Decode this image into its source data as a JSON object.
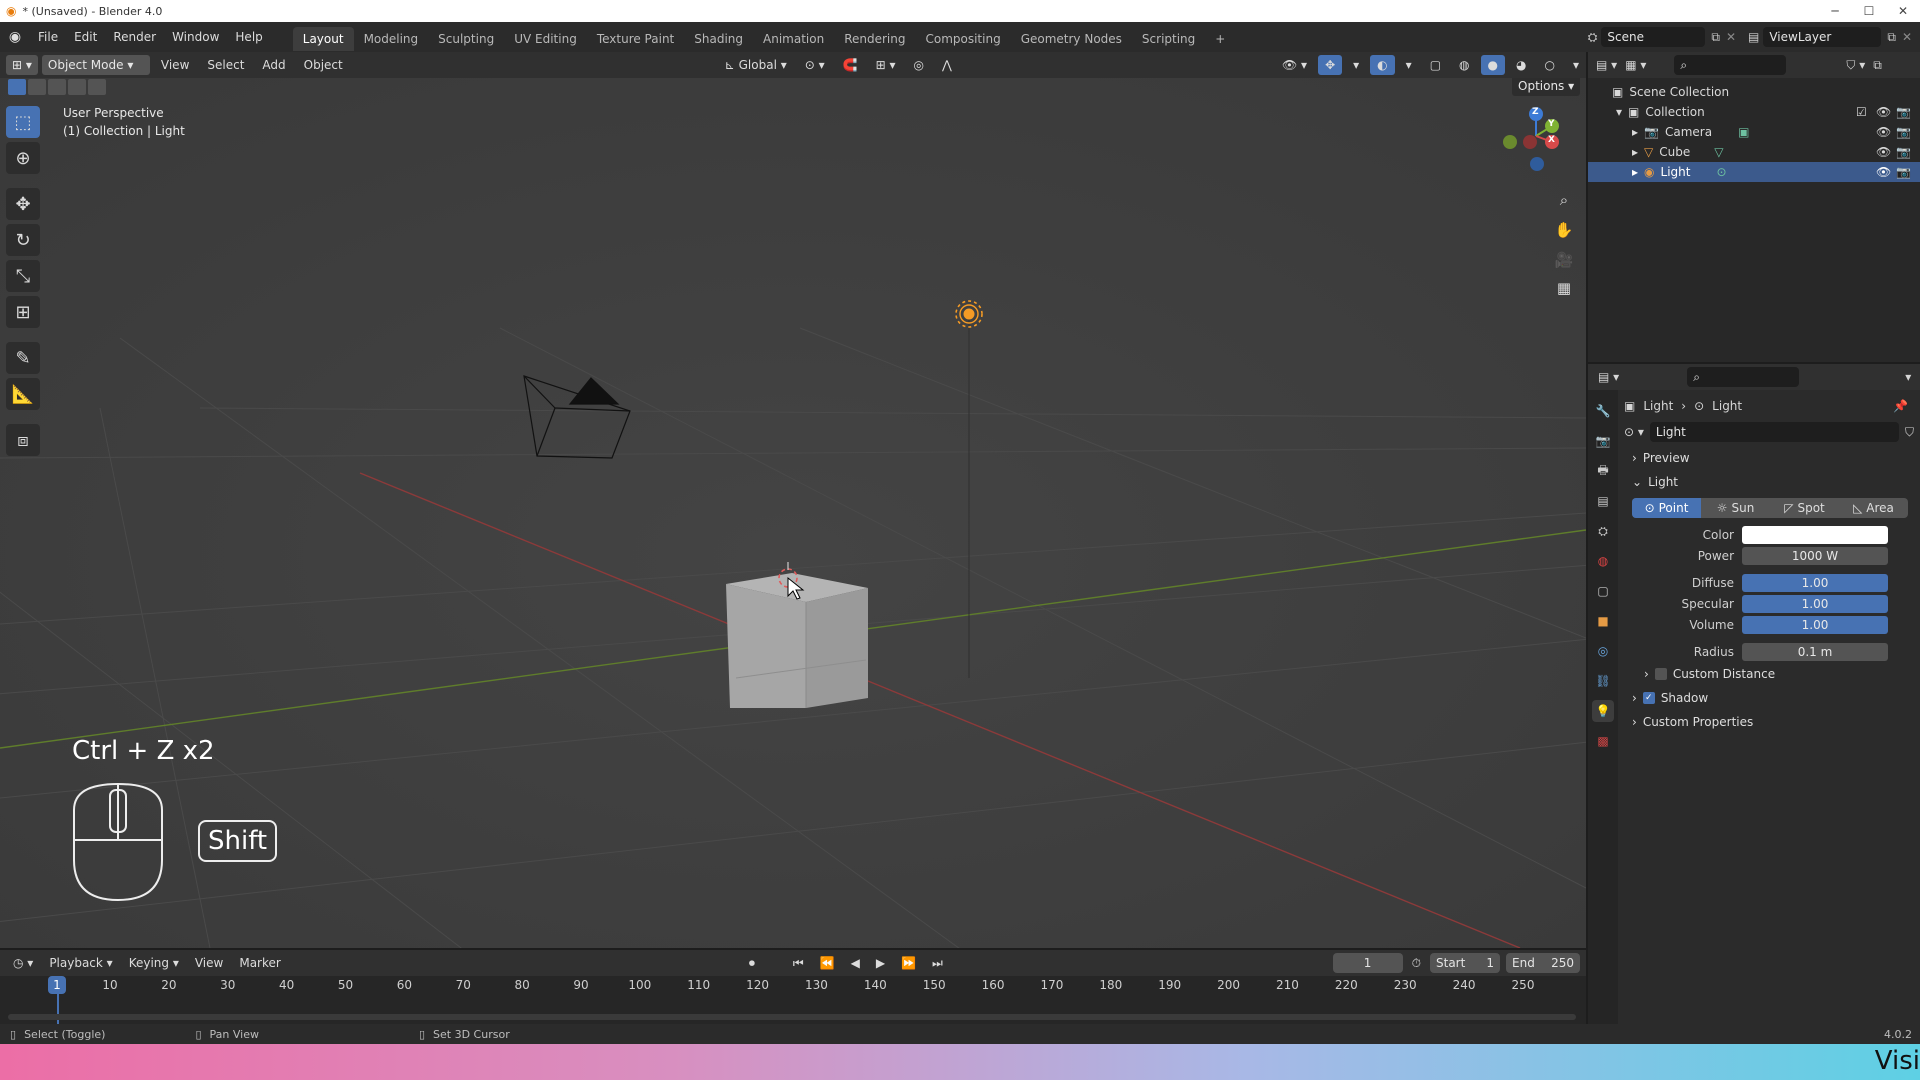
{
  "window": {
    "title": "* (Unsaved) - Blender 4.0",
    "controls": [
      "─",
      "☐",
      "✕"
    ]
  },
  "topbar": {
    "menus": [
      "File",
      "Edit",
      "Render",
      "Window",
      "Help"
    ],
    "workspace_tabs": [
      "Layout",
      "Modeling",
      "Sculpting",
      "UV Editing",
      "Texture Paint",
      "Shading",
      "Animation",
      "Rendering",
      "Compositing",
      "Geometry Nodes",
      "Scripting"
    ],
    "active_tab": "Layout",
    "add_tab": "+",
    "scene": "Scene",
    "view_layer": "ViewLayer"
  },
  "viewport_header": {
    "mode": "Object Mode",
    "menus": [
      "View",
      "Select",
      "Add",
      "Object"
    ],
    "transform_orientation": "Global",
    "options": "Options"
  },
  "viewport": {
    "perspective": "User Perspective",
    "collection_info": "(1) Collection | Light",
    "gizmo_axes": [
      "Z",
      "Y",
      "X"
    ],
    "shortcut_hint": "Ctrl + Z x2",
    "key_label": "Shift"
  },
  "outliner": {
    "root": "Scene Collection",
    "collection": "Collection",
    "items": [
      {
        "name": "Camera",
        "selected": false
      },
      {
        "name": "Cube",
        "selected": false
      },
      {
        "name": "Light",
        "selected": true
      }
    ]
  },
  "properties": {
    "breadcrumb": [
      "Light",
      "Light"
    ],
    "datablock_name": "Light",
    "panels": {
      "preview": "Preview",
      "light": "Light",
      "custom_distance": "Custom Distance",
      "shadow": "Shadow",
      "custom_properties": "Custom Properties"
    },
    "light_types": [
      "Point",
      "Sun",
      "Spot",
      "Area"
    ],
    "active_light_type": "Point",
    "fields": [
      {
        "label": "Color",
        "value": "",
        "style": "white"
      },
      {
        "label": "Power",
        "value": "1000 W",
        "style": "grey"
      },
      {
        "label": "Diffuse",
        "value": "1.00",
        "style": "blue"
      },
      {
        "label": "Specular",
        "value": "1.00",
        "style": "blue"
      },
      {
        "label": "Volume",
        "value": "1.00",
        "style": "blue"
      },
      {
        "label": "Radius",
        "value": "0.1 m",
        "style": "grey"
      }
    ],
    "shadow_enabled": true
  },
  "timeline": {
    "menus": [
      "Playback",
      "Keying",
      "View",
      "Marker"
    ],
    "current_frame": "1",
    "start_label": "Start",
    "start": "1",
    "end_label": "End",
    "end": "250",
    "ticks": [
      "1",
      "10",
      "20",
      "30",
      "40",
      "50",
      "60",
      "70",
      "80",
      "90",
      "100",
      "110",
      "120",
      "130",
      "140",
      "150",
      "160",
      "170",
      "180",
      "190",
      "200",
      "210",
      "220",
      "230",
      "240",
      "250"
    ]
  },
  "statusbar": {
    "hints": [
      "Select (Toggle)",
      "Pan View",
      "Set 3D Cursor"
    ],
    "version": "4.0.2"
  },
  "watermark": "Visi"
}
